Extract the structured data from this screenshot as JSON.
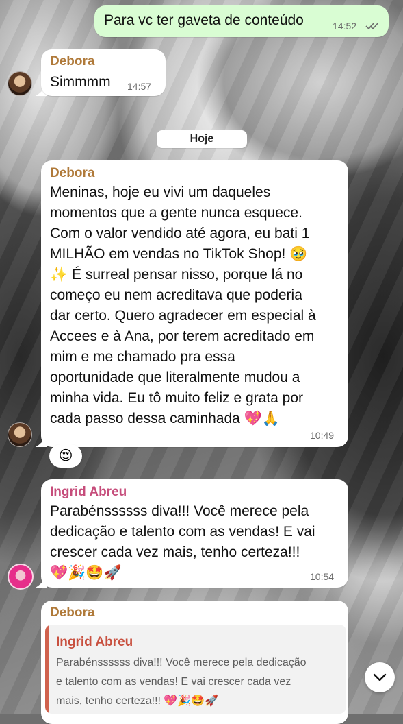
{
  "messages": {
    "outgoing": {
      "text": "Para vc ter gaveta de conteúdo",
      "time": "14:52",
      "status_icon": "double-check-icon"
    },
    "debora_1": {
      "sender": "Debora",
      "text": "Simmmm",
      "time": "14:57"
    },
    "date_separator": "Hoje",
    "debora_2": {
      "sender": "Debora",
      "lines": [
        "Meninas, hoje eu vivi um daqueles",
        "momentos que a gente nunca esquece.",
        "Com o valor vendido até agora, eu bati 1",
        "MILHÃO em vendas no TikTok Shop! 🥹",
        "✨ É surreal pensar nisso, porque lá no",
        "começo eu nem acreditava que poderia",
        "dar certo. Quero agradecer em especial à",
        "Accees e à Ana, por terem acreditado em",
        "mim e me chamado pra essa",
        "oportunidade que literalmente mudou a",
        "minha vida. Eu tô muito feliz e grata por",
        "cada passo dessa caminhada 💖🙏"
      ],
      "time": "10:49",
      "reaction": "😍"
    },
    "ingrid": {
      "sender": "Ingrid Abreu",
      "lines": [
        "Parabénssssss diva!!! Você merece pela",
        "dedicação e talento com as vendas! E vai",
        "crescer cada vez mais, tenho certeza!!!",
        "💖🎉🤩🚀"
      ],
      "time": "10:54"
    },
    "debora_3": {
      "sender": "Debora",
      "quote_sender": "Ingrid Abreu",
      "quote_lines": [
        "Parabénssssss diva!!! Você merece pela dedicação",
        "e talento com as vendas! E vai crescer cada vez",
        "mais, tenho certeza!!! 💖🎉🤩🚀"
      ]
    }
  },
  "scroll_button_icon": "chevron-down-icon"
}
